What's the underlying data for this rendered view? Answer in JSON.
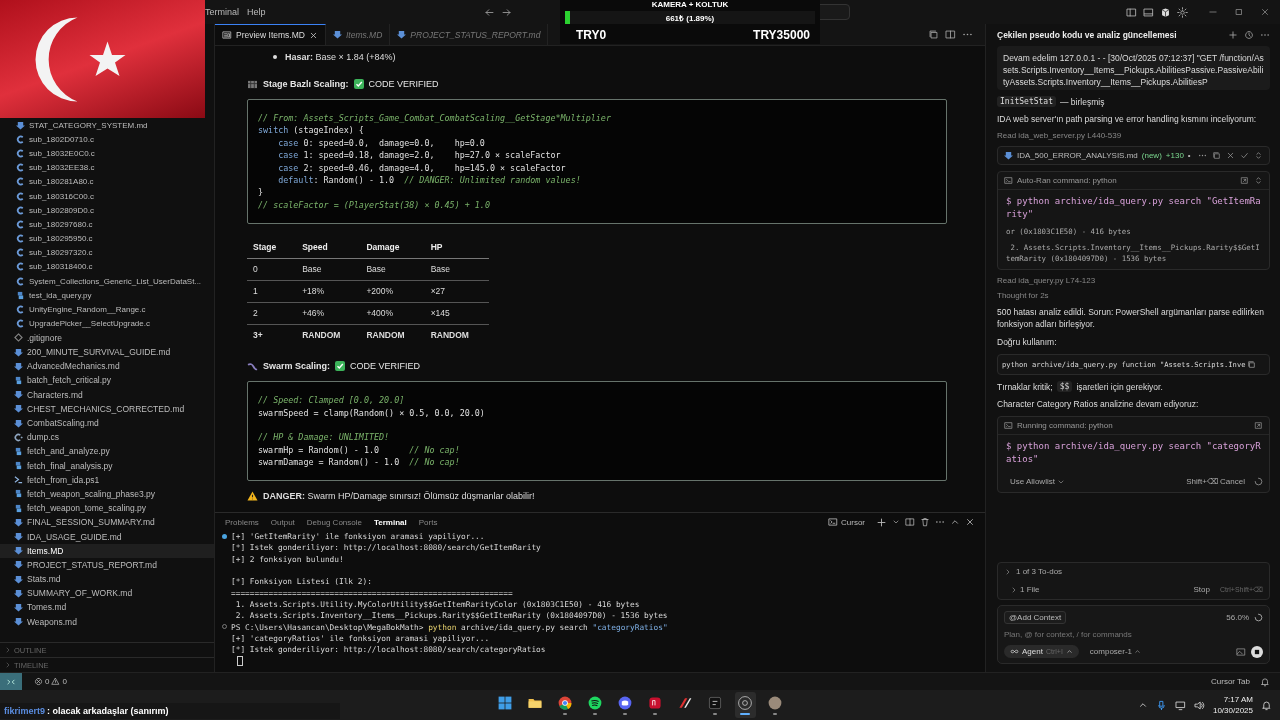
{
  "menu": [
    "Terminal",
    "Help"
  ],
  "donation": {
    "title": "KAMERA + KOLTUK",
    "level": 0.0189,
    "amount": "661₺ (1.89%)",
    "min_label": "TRY0",
    "max_label": "TRY35000"
  },
  "chat_overlay": {
    "user": "fikrimert9",
    "text": ": olacak arkadaşlar (sanırım)"
  },
  "sidebar": {
    "folder_files": [
      {
        "name": "STAT_CATEGORY_SYSTEM.md",
        "kind": "md",
        "selected": false
      },
      {
        "name": "sub_1802D0710.c",
        "kind": "c",
        "selected": false
      },
      {
        "name": "sub_18032E0C0.c",
        "kind": "c",
        "selected": false
      },
      {
        "name": "sub_18032EE38.c",
        "kind": "c",
        "selected": false
      },
      {
        "name": "sub_180281A80.c",
        "kind": "c",
        "selected": false
      },
      {
        "name": "sub_180316C00.c",
        "kind": "c",
        "selected": false
      },
      {
        "name": "sub_1802809D0.c",
        "kind": "c",
        "selected": false
      },
      {
        "name": "sub_180297680.c",
        "kind": "c",
        "selected": false
      },
      {
        "name": "sub_180295950.c",
        "kind": "c",
        "selected": false
      },
      {
        "name": "sub_180297320.c",
        "kind": "c",
        "selected": false
      },
      {
        "name": "sub_180318400.c",
        "kind": "c",
        "selected": false
      },
      {
        "name": "System_Collections_Generic_List_UserDataSt...",
        "kind": "c",
        "selected": false
      },
      {
        "name": "test_ida_query.py",
        "kind": "py",
        "selected": false
      },
      {
        "name": "UnityEngine_Random__Range.c",
        "kind": "c",
        "selected": false
      },
      {
        "name": "UpgradePicker__SelectUpgrade.c",
        "kind": "c",
        "selected": false
      }
    ],
    "files": [
      {
        "name": ".gitignore",
        "kind": "git",
        "selected": false
      },
      {
        "name": "200_MINUTE_SURVIVAL_GUIDE.md",
        "kind": "md",
        "selected": false
      },
      {
        "name": "AdvancedMechanics.md",
        "kind": "md",
        "selected": false
      },
      {
        "name": "batch_fetch_critical.py",
        "kind": "py",
        "selected": false
      },
      {
        "name": "Characters.md",
        "kind": "md",
        "selected": false
      },
      {
        "name": "CHEST_MECHANICS_CORRECTED.md",
        "kind": "md",
        "selected": false
      },
      {
        "name": "CombatScaling.md",
        "kind": "md",
        "selected": false
      },
      {
        "name": "dump.cs",
        "kind": "cs",
        "selected": false
      },
      {
        "name": "fetch_and_analyze.py",
        "kind": "py",
        "selected": false
      },
      {
        "name": "fetch_final_analysis.py",
        "kind": "py",
        "selected": false
      },
      {
        "name": "fetch_from_ida.ps1",
        "kind": "ps1",
        "selected": false
      },
      {
        "name": "fetch_weapon_scaling_phase3.py",
        "kind": "py",
        "selected": false
      },
      {
        "name": "fetch_weapon_tome_scaling.py",
        "kind": "py",
        "selected": false
      },
      {
        "name": "FINAL_SESSION_SUMMARY.md",
        "kind": "md",
        "selected": false
      },
      {
        "name": "IDA_USAGE_GUIDE.md",
        "kind": "md",
        "selected": false
      },
      {
        "name": "Items.MD",
        "kind": "md",
        "selected": true
      },
      {
        "name": "PROJECT_STATUS_REPORT.md",
        "kind": "md",
        "selected": false
      },
      {
        "name": "Stats.md",
        "kind": "md",
        "selected": false
      },
      {
        "name": "SUMMARY_OF_WORK.md",
        "kind": "md",
        "selected": false
      },
      {
        "name": "Tomes.md",
        "kind": "md",
        "selected": false
      },
      {
        "name": "Weapons.md",
        "kind": "md",
        "selected": false
      }
    ],
    "sections": [
      {
        "label": "OUTLINE",
        "expanded": false
      },
      {
        "label": "TIMELINE",
        "expanded": false
      }
    ]
  },
  "editor": {
    "tabs": [
      {
        "label": "Preview Items.MD",
        "kind": "preview",
        "selected": true
      },
      {
        "label": "Items.MD",
        "kind": "md",
        "selected": false
      },
      {
        "label": "PROJECT_STATUS_REPORT.md",
        "kind": "md",
        "selected": false
      }
    ],
    "blocks": [
      {
        "kind": "bullet",
        "text": "**Hasar:** Base × 1.84 (+84%)"
      },
      {
        "kind": "heading",
        "title": "Stage Bazlı Scaling:",
        "status": "CODE VERIFIED"
      },
      {
        "kind": "code",
        "lines": [
          {
            "kind": "code",
            "segments": [
              {
                "kind": "comment",
                "text": "// From: Assets_Scripts_Game_Combat_CombatScaling__GetStage*Multiplier"
              }
            ]
          },
          {
            "kind": "code",
            "segments": [
              {
                "kind": "kw",
                "text": "switch"
              },
              {
                "kind": "plain",
                "text": " (stageIndex) {"
              }
            ]
          },
          {
            "kind": "code",
            "segments": [
              {
                "kind": "kw",
                "text": "    case"
              },
              {
                "kind": "plain",
                "text": " 0: speed=0.0,  damage=0.0,    hp=0.0"
              }
            ]
          },
          {
            "kind": "code",
            "segments": [
              {
                "kind": "kw",
                "text": "    case"
              },
              {
                "kind": "plain",
                "text": " 1: speed=0.18, damage=2.0,    hp=27.0 × scaleFactor"
              }
            ]
          },
          {
            "kind": "code",
            "segments": [
              {
                "kind": "kw",
                "text": "    case"
              },
              {
                "kind": "plain",
                "text": " 2: speed=0.46, damage=4.0,    hp=145.0 × scaleFactor"
              }
            ]
          },
          {
            "kind": "code",
            "segments": [
              {
                "kind": "kw",
                "text": "    default"
              },
              {
                "kind": "plain",
                "text": ": Random() - 1.0  "
              },
              {
                "kind": "comment",
                "text": "// DANGER: Unlimited random values!"
              }
            ]
          },
          {
            "kind": "code",
            "segments": [
              {
                "kind": "plain",
                "text": "}"
              }
            ]
          },
          {
            "kind": "code",
            "segments": [
              {
                "kind": "comment",
                "text": "// scaleFactor = (PlayerStat(38) × 0.45) + 1.0"
              }
            ]
          }
        ]
      },
      {
        "kind": "table",
        "columns": [
          "Stage",
          "Speed",
          "Damage",
          "HP"
        ],
        "rows": [
          {
            "cells": [
              "0",
              "Base",
              "Base",
              "Base"
            ],
            "emphasis": false
          },
          {
            "cells": [
              "1",
              "+18%",
              "+200%",
              "×27"
            ],
            "emphasis": false
          },
          {
            "cells": [
              "2",
              "+46%",
              "+400%",
              "×145"
            ],
            "emphasis": false
          },
          {
            "cells": [
              "3+",
              "RANDOM",
              "RANDOM",
              "RANDOM"
            ],
            "emphasis": true
          }
        ]
      },
      {
        "kind": "heading",
        "title": "Swarm Scaling:",
        "status": "CODE VERIFIED"
      },
      {
        "kind": "code",
        "lines": [
          {
            "kind": "code",
            "segments": [
              {
                "kind": "comment",
                "text": "// Speed: Clamped [0.0, 20.0]"
              }
            ]
          },
          {
            "kind": "code",
            "segments": [
              {
                "kind": "plain",
                "text": "swarmSpeed = clamp(Random() × 0.5, 0.0, 20.0)"
              }
            ]
          },
          {
            "kind": "blank"
          },
          {
            "kind": "code",
            "segments": [
              {
                "kind": "comment",
                "text": "// HP & Damage: UNLIMITED!"
              }
            ]
          },
          {
            "kind": "code",
            "segments": [
              {
                "kind": "plain",
                "text": "swarmHp = Random() - 1.0      "
              },
              {
                "kind": "comment",
                "text": "// No cap!"
              }
            ]
          },
          {
            "kind": "code",
            "segments": [
              {
                "kind": "plain",
                "text": "swarmDamage = Random() - 1.0  "
              },
              {
                "kind": "comment",
                "text": "// No cap!"
              }
            ]
          }
        ]
      },
      {
        "kind": "warning",
        "text": "**DANGER:** Swarm HP/Damage sınırsız! Ölümsüz düşmanlar olabilir!"
      }
    ]
  },
  "terminal": {
    "tabs": [
      {
        "label": "Problems",
        "selected": false
      },
      {
        "label": "Output",
        "selected": false
      },
      {
        "label": "Debug Console",
        "selected": false
      },
      {
        "label": "Terminal",
        "selected": true
      },
      {
        "label": "Ports",
        "selected": false
      }
    ],
    "shell": "Cursor",
    "lines": [
      {
        "kind": "done",
        "segments": [
          {
            "kind": "plain",
            "text": "[+] 'GetItemRarity' ile fonksiyon aramasi yapiliyor..."
          }
        ]
      },
      {
        "kind": "text",
        "segments": [
          {
            "kind": "plain",
            "text": "[*] Istek gonderiliyor: http://localhost:8080/search/GetItemRarity"
          }
        ]
      },
      {
        "kind": "text",
        "segments": [
          {
            "kind": "plain",
            "text": "[+] 2 fonksiyon bulundu!"
          }
        ]
      },
      {
        "kind": "blank"
      },
      {
        "kind": "text",
        "segments": [
          {
            "kind": "plain",
            "text": "[*] Fonksiyon Listesi (Ilk 2):"
          }
        ]
      },
      {
        "kind": "text",
        "segments": [
          {
            "kind": "plain",
            "text": "============================================================"
          }
        ]
      },
      {
        "kind": "text",
        "segments": [
          {
            "kind": "plain",
            "text": " 1. Assets.Scripts.Utility.MyColorUtility$$GetItemRarityColor (0x1803C1E50) - 416 bytes"
          }
        ]
      },
      {
        "kind": "text",
        "segments": [
          {
            "kind": "plain",
            "text": " 2. Assets.Scripts.Inventory__Items__Pickups.Rarity$$GetItemRarity (0x1804097D0) - 1536 bytes"
          }
        ]
      },
      {
        "kind": "prompt",
        "segments": [
          {
            "kind": "plain",
            "text": "PS C:\\Users\\Hasancan\\Desktop\\MegaBokMath> "
          },
          {
            "kind": "cmd",
            "text": "python"
          },
          {
            "kind": "plain",
            "text": " archive/ida_query.py search "
          },
          {
            "kind": "str",
            "text": "\"categoryRatios\""
          }
        ]
      },
      {
        "kind": "text",
        "segments": [
          {
            "kind": "plain",
            "text": "[+] 'categoryRatios' ile fonksiyon aramasi yapiliyor..."
          }
        ]
      },
      {
        "kind": "text",
        "segments": [
          {
            "kind": "plain",
            "text": "[*] Istek gonderiliyor: http://localhost:8080/search/categoryRatios"
          }
        ]
      },
      {
        "kind": "cursor"
      }
    ]
  },
  "agent": {
    "title": "Çekilen pseudo kodu ve analiz güncellemesi",
    "items": [
      {
        "kind": "user_message",
        "text": "Devam edelim 127.0.0.1 - - [30/Oct/2025 07:12:37] \"GET /function/Assets.Scripts.Inventory__Items__Pickups.AbilitiesPassive.PassiveAbilityAssets.Scripts.Inventory__Items__Pickups.AbilitiesP"
      },
      {
        "kind": "code_note",
        "code": "InitSetStat",
        "text": "— birleşmiş"
      },
      {
        "kind": "text",
        "text": "IDA web server'ın path parsing ve error handling kısmını inceliyorum:"
      },
      {
        "kind": "muted",
        "text": "Read ida_web_server.py L440-539"
      },
      {
        "kind": "file_change",
        "file": "IDA_500_ERROR_ANALYSIS.md",
        "tag": "(new)",
        "count": "+130",
        "dot": "•"
      },
      {
        "kind": "command",
        "header": "Auto-Ran command: python",
        "command": "$ python archive/ida_query.py search \"GetItemRarity\"",
        "output": [
          "or (0x1803C1E50) - 416 bytes",
          " 2. Assets.Scripts.Inventory__Items__Pickups.Rarity$$GetItemRarity (0x1804097D0) - 1536 bytes"
        ]
      },
      {
        "kind": "muted",
        "text": "Read ida_query.py L74-123"
      },
      {
        "kind": "muted",
        "text": "Thought for 2s"
      },
      {
        "kind": "text",
        "text": "500 hatası analiz edildi. Sorun: PowerShell argümanları parse edilirken fonksiyon adları birleşiyor."
      },
      {
        "kind": "text",
        "text": "Doğru kullanım:"
      },
      {
        "kind": "snippet",
        "text": "python archive/ida_query.py function \"Assets.Scripts.Inve"
      },
      {
        "kind": "text_code",
        "before": "Tırnaklar kritik;",
        "code": "$$",
        "after": "işaretleri için gerekiyor."
      },
      {
        "kind": "text",
        "text": "Character Category Ratios analizine devam ediyoruz:"
      },
      {
        "kind": "running",
        "header": "Running command: python",
        "command": "$ python archive/ida_query.py search \"categoryRatios\"",
        "allow": "Use Allowlist",
        "cancel": "Shift+⌫ Cancel"
      }
    ],
    "todos": "1 of 3 To-dos",
    "files": "1 File",
    "stop": "Stop",
    "stop_hint": "Ctrl+Shift+⌫",
    "context": "@Add Context",
    "usage": "56.0%",
    "placeholder": "Plan, @ for context, / for commands",
    "mode": "Agent",
    "mode_hint": "Ctrl+I",
    "model": "composer-1"
  },
  "status_bar": {
    "errors": "0",
    "warnings": "0",
    "right": "Cursor Tab"
  },
  "taskbar": {
    "apps": [
      {
        "kind": "start",
        "running": false,
        "selected": false
      },
      {
        "kind": "folder",
        "running": false,
        "selected": false
      },
      {
        "kind": "browser",
        "running": true,
        "selected": false
      },
      {
        "kind": "music",
        "running": true,
        "selected": false
      },
      {
        "kind": "chat",
        "running": true,
        "selected": false
      },
      {
        "kind": "red",
        "running": true,
        "selected": false
      },
      {
        "kind": "slash",
        "running": false,
        "selected": false
      },
      {
        "kind": "dark",
        "running": true,
        "selected": false
      },
      {
        "kind": "aperture",
        "running": true,
        "selected": true
      },
      {
        "kind": "avatar",
        "running": true,
        "selected": false
      }
    ],
    "time": "7:17 AM",
    "date": "10/30/2025"
  }
}
